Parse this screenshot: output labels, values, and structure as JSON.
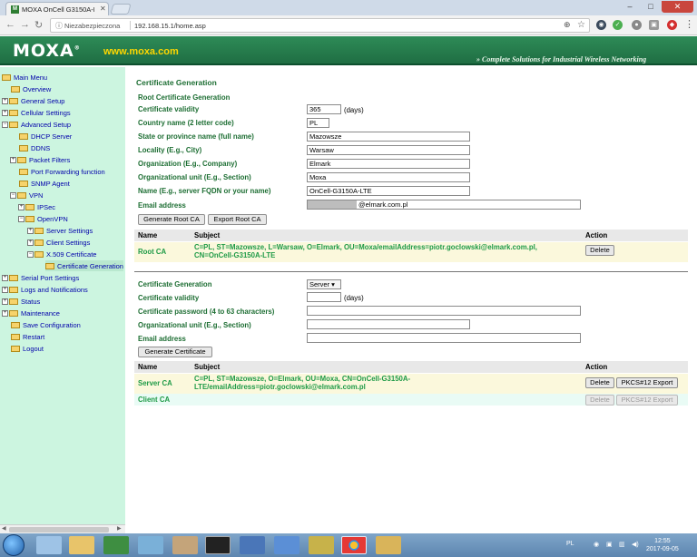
{
  "browser": {
    "tab_title": "MOXA OnCell G3150A-L",
    "security_label": "Niezabezpieczona",
    "url": "192.168.15.1/home.asp"
  },
  "header": {
    "logo": "MOXA",
    "logo_mark": "®",
    "website": "www.moxa.com",
    "tagline": "» Complete Solutions for Industrial Wireless Networking"
  },
  "sidebar": {
    "items": [
      {
        "label": "Main Menu"
      },
      {
        "label": "Overview"
      },
      {
        "label": "General Setup"
      },
      {
        "label": "Cellular Settings"
      },
      {
        "label": "Advanced Setup"
      },
      {
        "label": "DHCP Server"
      },
      {
        "label": "DDNS"
      },
      {
        "label": "Packet Filters"
      },
      {
        "label": "Port Forwarding function"
      },
      {
        "label": "SNMP Agent"
      },
      {
        "label": "VPN"
      },
      {
        "label": "IPSec"
      },
      {
        "label": "OpenVPN"
      },
      {
        "label": "Server Settings"
      },
      {
        "label": "Client Settings"
      },
      {
        "label": "X.509 Certificate"
      },
      {
        "label": "Certificate Generation"
      },
      {
        "label": "Serial Port Settings"
      },
      {
        "label": "Logs and Notifications"
      },
      {
        "label": "Status"
      },
      {
        "label": "Maintenance"
      },
      {
        "label": "Save Configuration"
      },
      {
        "label": "Restart"
      },
      {
        "label": "Logout"
      }
    ]
  },
  "page": {
    "title": "Certificate Generation",
    "root_section": "Root Certificate Generation",
    "root_fields": [
      {
        "label": "Certificate validity",
        "value": "365",
        "suffix": "(days)"
      },
      {
        "label": "Country name (2 letter code)",
        "value": "PL"
      },
      {
        "label": "State or province name (full name)",
        "value": "Mazowsze"
      },
      {
        "label": "Locality (E.g., City)",
        "value": "Warsaw"
      },
      {
        "label": "Organization (E.g., Company)",
        "value": "Elmark"
      },
      {
        "label": "Organizational unit (E.g., Section)",
        "value": "Moxa"
      },
      {
        "label": "Name (E.g., server FQDN or your name)",
        "value": "OnCell-G3150A-LTE"
      },
      {
        "label": "Email address",
        "value": "@elmark.com.pl"
      }
    ],
    "btn_generate_root": "Generate Root CA",
    "btn_export_root": "Export Root CA",
    "table1": {
      "headers": [
        "Name",
        "Subject",
        "Action"
      ],
      "rows": [
        {
          "name": "Root CA",
          "subject_line1": "C=PL, ST=Mazowsze, L=Warsaw, O=Elmark, OU=Moxa/emailAddress=piotr.goclowski@elmark.com.pl,",
          "subject_line2": "CN=OnCell-G3150A-LTE",
          "action": "Delete"
        }
      ]
    },
    "cert_fields": [
      {
        "label": "Certificate Generation",
        "value": "Server ▾"
      },
      {
        "label": "Certificate validity",
        "value": "",
        "suffix": "(days)"
      },
      {
        "label": "Certificate password (4 to 63 characters)",
        "value": ""
      },
      {
        "label": "Organizational unit (E.g., Section)",
        "value": ""
      },
      {
        "label": "Email address",
        "value": ""
      }
    ],
    "btn_generate_cert": "Generate Certificate",
    "table2": {
      "headers": [
        "Name",
        "Subject",
        "Action"
      ],
      "rows": [
        {
          "name": "Server CA",
          "subject_line1": "C=PL, ST=Mazowsze, O=Elmark, OU=Moxa, CN=OnCell-G3150A-",
          "subject_line2": "LTE/emailAddress=piotr.goclowski@elmark.com.pl",
          "delete": "Delete",
          "export": "PKCS#12 Export"
        },
        {
          "name": "Client CA",
          "subject_line1": "",
          "subject_line2": "",
          "delete": "Delete",
          "export": "PKCS#12 Export"
        }
      ]
    }
  },
  "taskbar": {
    "lang": "PL",
    "time": "12:55",
    "date": "2017-09-05"
  },
  "colors": {
    "header_green": "#2e8b57",
    "sidebar_bg": "#ccf5e0",
    "label_green": "#1d6e33",
    "subject_green": "#1e9a46"
  }
}
